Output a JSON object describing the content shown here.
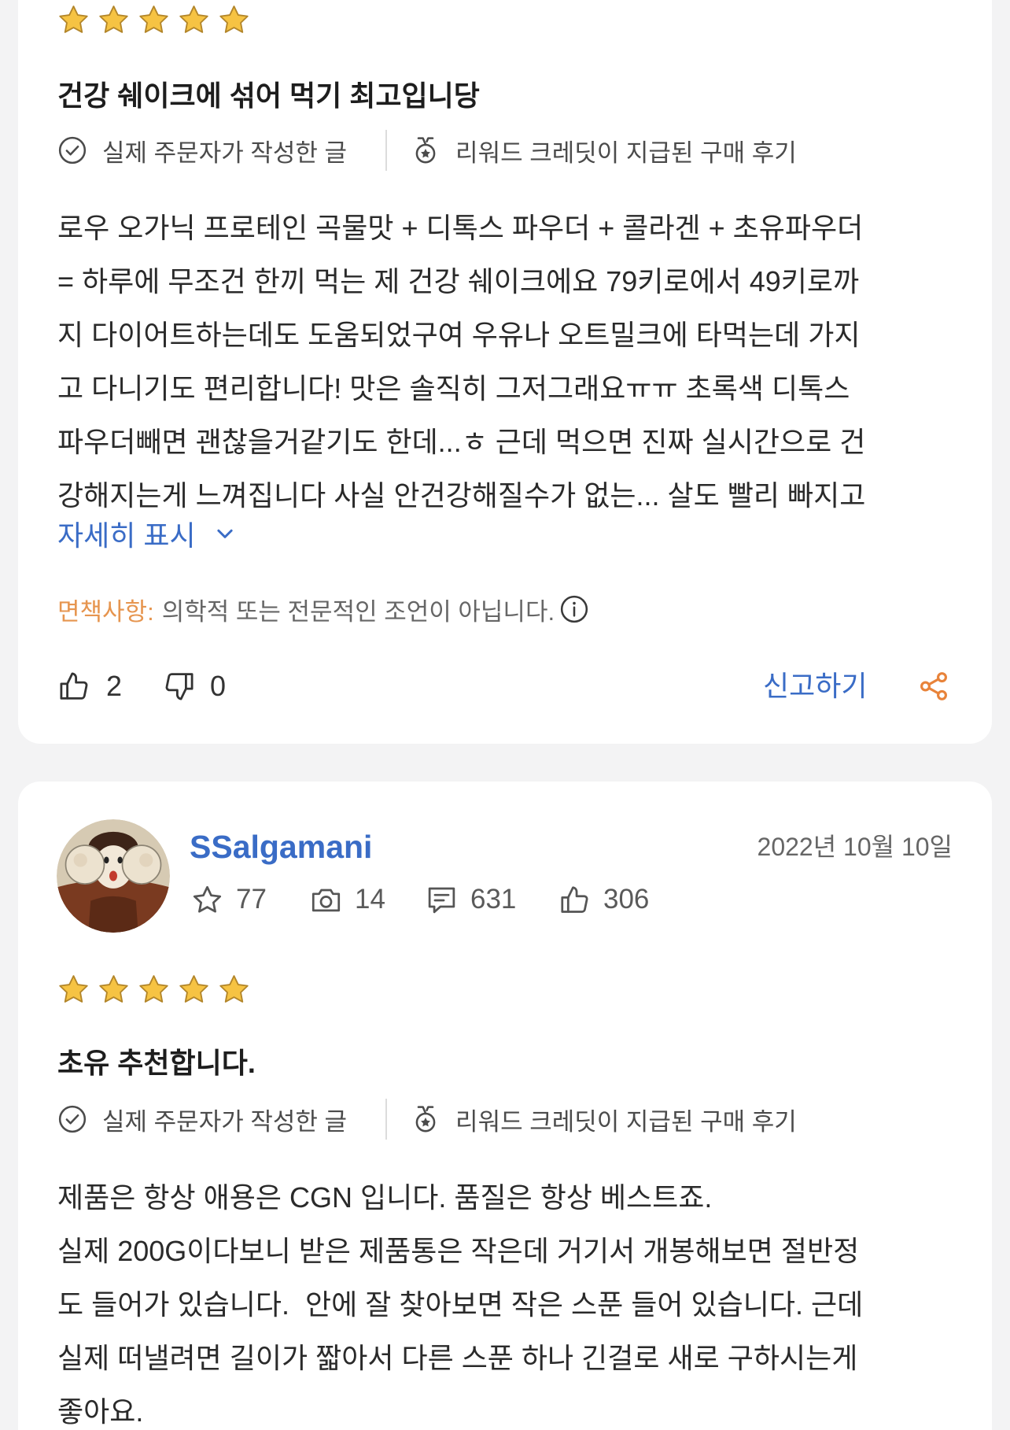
{
  "colors": {
    "page_background": "#f3f3f4",
    "card_background": "#ffffff",
    "text_primary": "#2a2a2a",
    "text_strong": "#1d1d1d",
    "text_secondary": "#4b4b4b",
    "text_muted": "#666666",
    "link_blue": "#3a6cc6",
    "disclaimer_orange": "#e6954f",
    "share_orange": "#e8833a",
    "divider": "#dcdcdc",
    "star_fill": "#f6c343",
    "star_outline": "#b3862a"
  },
  "reviews": [
    {
      "rating": 5,
      "rating_max": 5,
      "title": "건강 쉐이크에 섞어 먹기 최고입니당",
      "badges": [
        {
          "icon": "check-circle-icon",
          "label": "실제 주문자가 작성한 글"
        },
        {
          "icon": "reward-medal-icon",
          "label": "리워드 크레딧이 지급된 구매 후기"
        }
      ],
      "body_lines": [
        "로우 오가닉 프로테인 곡물맛 + 디톡스 파우더 + 콜라겐 + 초유파우더",
        "= 하루에 무조건 한끼 먹는 제 건강 쉐이크에요 79키로에서 49키로까",
        "지 다이어트하는데도 도움되었구여 우유나 오트밀크에 타먹는데 가지",
        "고 다니기도 편리합니다! 맛은 솔직히 그저그래요ㅠㅠ 초록색 디톡스",
        "파우더빼면 괜찮을거같기도 한데...ㅎ 근데 먹으면 진짜 실시간으로 건",
        "강해지는게 느껴집니다 사실 안건강해질수가 없는... 살도 빨리 빠지고"
      ],
      "show_more_label": "자세히 표시",
      "disclaimer": {
        "label": "면책사항:",
        "text": "의학적 또는 전문적인 조언이 아닙니다.",
        "icon": "info-circle-icon"
      },
      "helpful": {
        "up_count": "2",
        "down_count": "0"
      },
      "report_label": "신고하기",
      "share_icon": "share-icon"
    },
    {
      "author": {
        "name": "SSalgamani",
        "stats": [
          {
            "icon": "star-outline-icon",
            "value": "77"
          },
          {
            "icon": "camera-icon",
            "value": "14"
          },
          {
            "icon": "comment-icon",
            "value": "631"
          },
          {
            "icon": "thumbs-up-icon",
            "value": "306"
          }
        ]
      },
      "date": "2022년 10월 10일",
      "rating": 5,
      "rating_max": 5,
      "title": "초유 추천합니다.",
      "badges": [
        {
          "icon": "check-circle-icon",
          "label": "실제 주문자가 작성한 글"
        },
        {
          "icon": "reward-medal-icon",
          "label": "리워드 크레딧이 지급된 구매 후기"
        }
      ],
      "body_lines": [
        "제품은 항상 애용은 CGN 입니다. 품질은 항상 베스트죠.",
        "실제 200G이다보니 받은 제품통은 작은데 거기서 개봉해보면 절반정",
        "도 들어가 있습니다.  안에 잘 찾아보면 작은 스푼 들어 있습니다. 근데",
        "실제 떠낼려면 길이가 짧아서 다른 스푼 하나 긴걸로 새로 구하시는게",
        "좋아요."
      ]
    }
  ]
}
